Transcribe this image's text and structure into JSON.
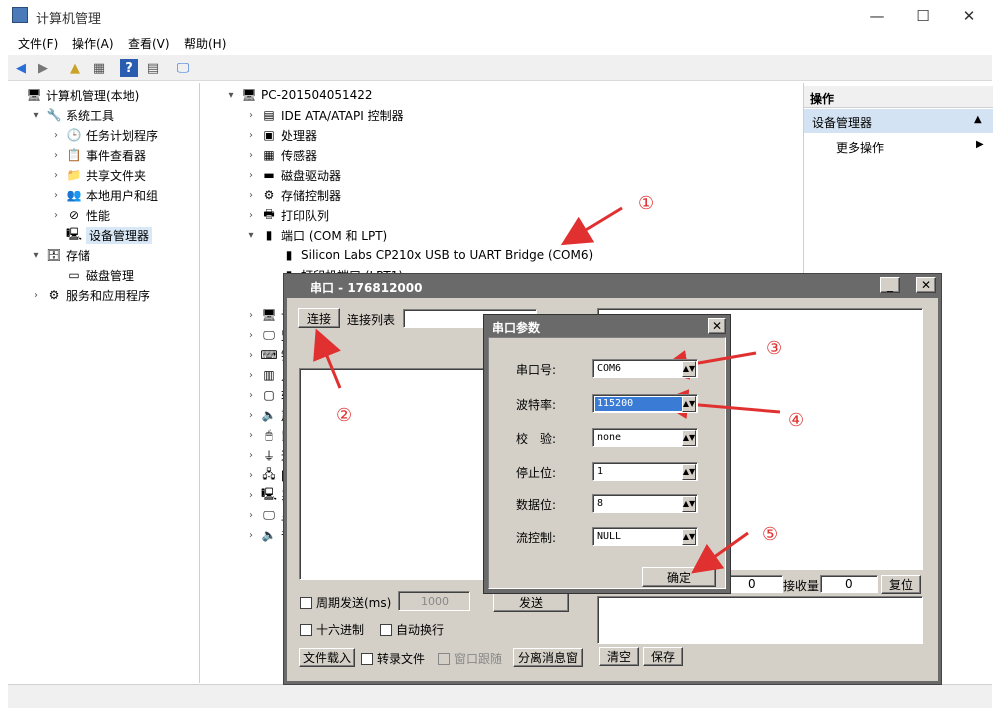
{
  "window": {
    "title": "计算机管理",
    "min": "—",
    "max": "☐",
    "close": "✕"
  },
  "menu": [
    "文件(F)",
    "操作(A)",
    "查看(V)",
    "帮助(H)"
  ],
  "left_tree": [
    {
      "label": "计算机管理(本地)",
      "level": 0,
      "arrow": "",
      "icon": "computer-icon",
      "glyph": "🖥"
    },
    {
      "label": "系统工具",
      "level": 1,
      "arrow": "▾",
      "icon": "tools-icon",
      "glyph": "🔧"
    },
    {
      "label": "任务计划程序",
      "level": 2,
      "arrow": "›",
      "icon": "clock-icon",
      "glyph": "🕒"
    },
    {
      "label": "事件查看器",
      "level": 2,
      "arrow": "›",
      "icon": "event-icon",
      "glyph": "📋"
    },
    {
      "label": "共享文件夹",
      "level": 2,
      "arrow": "›",
      "icon": "folder-icon",
      "glyph": "📁"
    },
    {
      "label": "本地用户和组",
      "level": 2,
      "arrow": "›",
      "icon": "users-icon",
      "glyph": "👥"
    },
    {
      "label": "性能",
      "level": 2,
      "arrow": "›",
      "icon": "performance-icon",
      "glyph": "⊘"
    },
    {
      "label": "设备管理器",
      "level": 2,
      "arrow": "",
      "icon": "device-manager-icon",
      "glyph": "🖳",
      "selected": true
    },
    {
      "label": "存储",
      "level": 1,
      "arrow": "▾",
      "icon": "storage-icon",
      "glyph": "🗄"
    },
    {
      "label": "磁盘管理",
      "level": 2,
      "arrow": "",
      "icon": "disk-icon",
      "glyph": "▭"
    },
    {
      "label": "服务和应用程序",
      "level": 1,
      "arrow": "›",
      "icon": "services-icon",
      "glyph": "⚙"
    }
  ],
  "device_tree": [
    {
      "label": "PC-201504051422",
      "level": 0,
      "arrow": "▾",
      "icon": "computer-icon",
      "glyph": "🖥"
    },
    {
      "label": "IDE ATA/ATAPI 控制器",
      "level": 1,
      "arrow": "›",
      "icon": "ide-icon",
      "glyph": "▤"
    },
    {
      "label": "处理器",
      "level": 1,
      "arrow": "›",
      "icon": "cpu-icon",
      "glyph": "▣"
    },
    {
      "label": "传感器",
      "level": 1,
      "arrow": "›",
      "icon": "sensor-icon",
      "glyph": "▦"
    },
    {
      "label": "磁盘驱动器",
      "level": 1,
      "arrow": "›",
      "icon": "disk-drive-icon",
      "glyph": "▬"
    },
    {
      "label": "存储控制器",
      "level": 1,
      "arrow": "›",
      "icon": "storage-controller-icon",
      "glyph": "⚙"
    },
    {
      "label": "打印队列",
      "level": 1,
      "arrow": "›",
      "icon": "printer-icon",
      "glyph": "🖶"
    },
    {
      "label": "端口 (COM 和 LPT)",
      "level": 1,
      "arrow": "▾",
      "icon": "port-icon",
      "glyph": "▮"
    },
    {
      "label": "Silicon Labs CP210x USB to UART Bridge (COM6)",
      "level": 2,
      "arrow": "",
      "icon": "port-icon",
      "glyph": "▮"
    },
    {
      "label": "打印机端口 (LPT1)",
      "level": 2,
      "arrow": "",
      "icon": "port-icon",
      "glyph": "▮"
    },
    {
      "label": "",
      "level": 2,
      "arrow": "",
      "icon": "port-icon",
      "glyph": "▮"
    },
    {
      "label": "计算",
      "level": 1,
      "arrow": "›",
      "icon": "computer-icon",
      "glyph": "🖥"
    },
    {
      "label": "监视",
      "level": 1,
      "arrow": "›",
      "icon": "monitor-icon",
      "glyph": "🖵"
    },
    {
      "label": "键盘",
      "level": 1,
      "arrow": "›",
      "icon": "keyboard-icon",
      "glyph": "⌨"
    },
    {
      "label": "人体",
      "level": 1,
      "arrow": "›",
      "icon": "hid-icon",
      "glyph": "▥"
    },
    {
      "label": "软件",
      "level": 1,
      "arrow": "›",
      "icon": "software-icon",
      "glyph": "▢"
    },
    {
      "label": "声音",
      "level": 1,
      "arrow": "›",
      "icon": "sound-icon",
      "glyph": "🔈"
    },
    {
      "label": "鼠标",
      "level": 1,
      "arrow": "›",
      "icon": "mouse-icon",
      "glyph": "🖱"
    },
    {
      "label": "通用",
      "level": 1,
      "arrow": "›",
      "icon": "usb-icon",
      "glyph": "⏚"
    },
    {
      "label": "网络",
      "level": 1,
      "arrow": "›",
      "icon": "network-icon",
      "glyph": "🖧"
    },
    {
      "label": "系统",
      "level": 1,
      "arrow": "›",
      "icon": "system-icon",
      "glyph": "🖳"
    },
    {
      "label": "显示",
      "level": 1,
      "arrow": "›",
      "icon": "display-icon",
      "glyph": "🖵"
    },
    {
      "label": "音频",
      "level": 1,
      "arrow": "›",
      "icon": "audio-icon",
      "glyph": "🔈"
    }
  ],
  "actions": {
    "header": "操作",
    "section": "设备管理器",
    "section_arrow": "▲",
    "more": "更多操作",
    "more_arrow": "▶"
  },
  "serial": {
    "title": "串口 - 176812000",
    "min": "_",
    "close": "✕",
    "connect": "连接",
    "conn_list": "连接列表",
    "periodic": "周期发送(ms)",
    "period_value": "1000",
    "send": "发送",
    "hex": "十六进制",
    "autowrap": "自动换行",
    "load_file": "文件载入",
    "record_file": "转录文件",
    "follow": "窗口跟随",
    "detach": "分离消息窗",
    "sent_count": "0",
    "recv_label": "接收量",
    "recv_count": "0",
    "reset": "复位",
    "clear": "清空",
    "save": "保存"
  },
  "dialog": {
    "title": "串口参数",
    "close": "✕",
    "fields": [
      {
        "label": "串口号:",
        "value": "COM6"
      },
      {
        "label": "波特率:",
        "value": "115200",
        "highlight": true
      },
      {
        "label": "校　验:",
        "value": "none"
      },
      {
        "label": "停止位:",
        "value": "1"
      },
      {
        "label": "数据位:",
        "value": "8"
      },
      {
        "label": "流控制:",
        "value": "NULL"
      }
    ],
    "ok": "确定"
  },
  "annotations": [
    "①",
    "②",
    "③",
    "④",
    "⑤"
  ],
  "colors": {
    "annotation": "#e03030",
    "dialog_title": "#6a6a6a",
    "selected": "#d9e8f7",
    "highlight": "#3a7bd5"
  }
}
